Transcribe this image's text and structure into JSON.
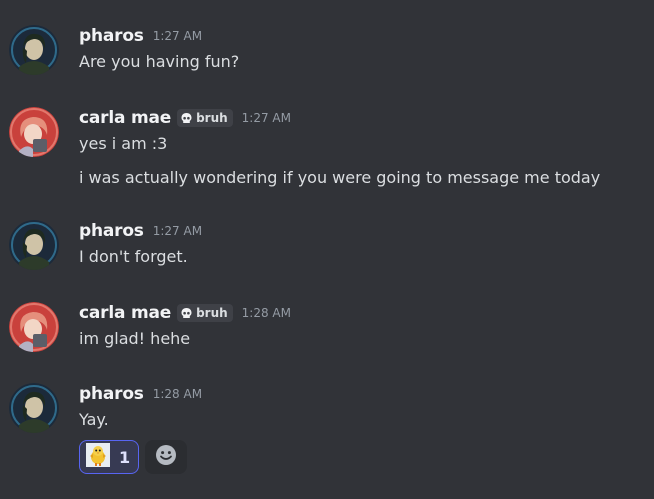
{
  "messages": [
    {
      "username": "pharos",
      "time": "1:27 AM",
      "lines": [
        "Are you having fun?"
      ]
    },
    {
      "username": "carla mae",
      "tag": "bruh",
      "time": "1:27 AM",
      "lines": [
        "yes i am :3",
        "i was actually wondering if you were going to message me today"
      ]
    },
    {
      "username": "pharos",
      "time": "1:27 AM",
      "lines": [
        "I don't forget."
      ]
    },
    {
      "username": "carla mae",
      "tag": "bruh",
      "time": "1:28 AM",
      "lines": [
        "im glad! hehe"
      ]
    },
    {
      "username": "pharos",
      "time": "1:28 AM",
      "lines": [
        "Yay."
      ],
      "reactions": [
        {
          "emoji": "custom-chick-emoji",
          "count": "1"
        }
      ]
    }
  ],
  "colors": {
    "background": "#313338",
    "username": "#f2f3f5",
    "timestamp": "#949ba4",
    "text": "#dbdee1",
    "reaction_active_bg": "#373a53",
    "reaction_active_border": "#5865f2"
  },
  "icons": {
    "tag_icon": "skull-icon",
    "add_reaction_icon": "smiley-icon"
  }
}
